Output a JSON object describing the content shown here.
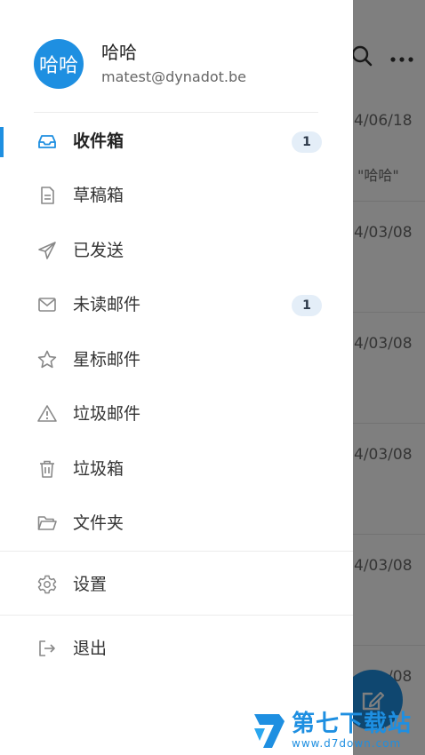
{
  "profile": {
    "avatar_text": "哈哈",
    "name": "哈哈",
    "email": "matest@dynadot.be"
  },
  "menu": [
    {
      "label": "收件箱",
      "icon": "inbox-icon",
      "badge": "1",
      "active": true
    },
    {
      "label": "草稿箱",
      "icon": "draft-icon"
    },
    {
      "label": "已发送",
      "icon": "send-icon"
    },
    {
      "label": "未读邮件",
      "icon": "envelope-icon",
      "badge": "1"
    },
    {
      "label": "星标邮件",
      "icon": "star-icon"
    },
    {
      "label": "垃圾邮件",
      "icon": "warning-icon"
    },
    {
      "label": "垃圾箱",
      "icon": "trash-icon"
    },
    {
      "label": "文件夹",
      "icon": "folder-icon"
    }
  ],
  "settings": {
    "label": "设置",
    "icon": "gear-icon"
  },
  "logout": {
    "label": "退出",
    "icon": "logout-icon"
  },
  "background_list": {
    "rows": [
      {
        "date": "4/06/18",
        "snippet": "\"哈哈\""
      },
      {
        "date": "4/03/08"
      },
      {
        "date": "4/03/08"
      },
      {
        "date": "4/03/08"
      },
      {
        "date": "4/03/08"
      },
      {
        "date": "/08"
      }
    ]
  },
  "watermark": {
    "title": "第七下载站",
    "url": "www.d7down.com"
  },
  "colors": {
    "accent": "#1e8fe1",
    "badge_bg": "#e4eef8",
    "overlay": "rgba(0,0,0,0.5)"
  }
}
